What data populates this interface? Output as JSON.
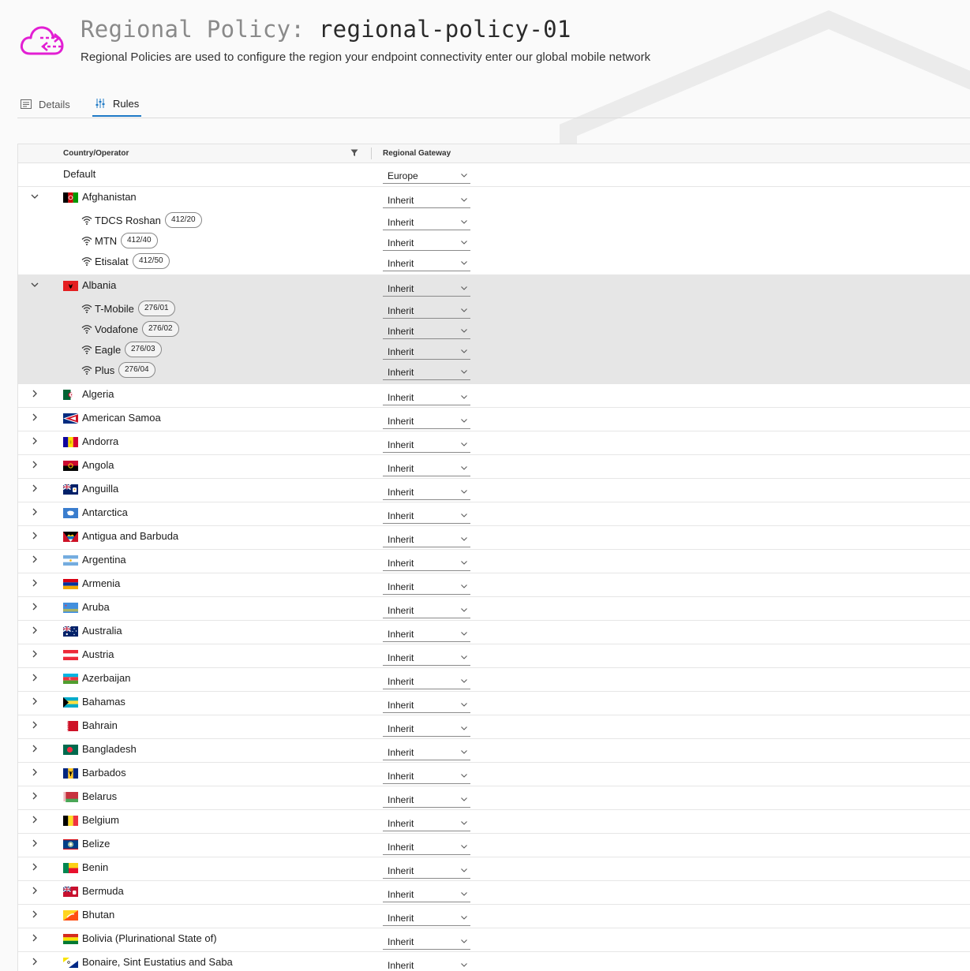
{
  "header": {
    "title_prefix": "Regional Policy:",
    "title_name": "regional-policy-01",
    "subtitle": "Regional Policies are used to configure the region your endpoint connectivity enter our global mobile network",
    "logo_color": "#e21fd3"
  },
  "tabs": [
    {
      "label": "Details",
      "icon": "details-icon",
      "active": false
    },
    {
      "label": "Rules",
      "icon": "sliders-icon",
      "active": true
    }
  ],
  "table": {
    "columns": {
      "country": "Country/Operator",
      "gateway": "Regional Gateway"
    },
    "default_row": {
      "label": "Default",
      "gateway": "Europe"
    },
    "countries": [
      {
        "name": "Afghanistan",
        "gateway": "Inherit",
        "expanded": true,
        "flag": "af",
        "operators": [
          {
            "name": "TDCS Roshan",
            "code": "412/20",
            "gateway": "Inherit"
          },
          {
            "name": "MTN",
            "code": "412/40",
            "gateway": "Inherit"
          },
          {
            "name": "Etisalat",
            "code": "412/50",
            "gateway": "Inherit"
          }
        ]
      },
      {
        "name": "Albania",
        "gateway": "Inherit",
        "expanded": true,
        "highlighted": true,
        "flag": "al",
        "operators": [
          {
            "name": "T-Mobile",
            "code": "276/01",
            "gateway": "Inherit"
          },
          {
            "name": "Vodafone",
            "code": "276/02",
            "gateway": "Inherit"
          },
          {
            "name": "Eagle",
            "code": "276/03",
            "gateway": "Inherit"
          },
          {
            "name": "Plus",
            "code": "276/04",
            "gateway": "Inherit"
          }
        ]
      },
      {
        "name": "Algeria",
        "gateway": "Inherit",
        "flag": "dz"
      },
      {
        "name": "American Samoa",
        "gateway": "Inherit",
        "flag": "as"
      },
      {
        "name": "Andorra",
        "gateway": "Inherit",
        "flag": "ad"
      },
      {
        "name": "Angola",
        "gateway": "Inherit",
        "flag": "ao"
      },
      {
        "name": "Anguilla",
        "gateway": "Inherit",
        "flag": "ai"
      },
      {
        "name": "Antarctica",
        "gateway": "Inherit",
        "flag": "aq"
      },
      {
        "name": "Antigua and Barbuda",
        "gateway": "Inherit",
        "flag": "ag"
      },
      {
        "name": "Argentina",
        "gateway": "Inherit",
        "flag": "ar"
      },
      {
        "name": "Armenia",
        "gateway": "Inherit",
        "flag": "am"
      },
      {
        "name": "Aruba",
        "gateway": "Inherit",
        "flag": "aw"
      },
      {
        "name": "Australia",
        "gateway": "Inherit",
        "flag": "au"
      },
      {
        "name": "Austria",
        "gateway": "Inherit",
        "flag": "at"
      },
      {
        "name": "Azerbaijan",
        "gateway": "Inherit",
        "flag": "az"
      },
      {
        "name": "Bahamas",
        "gateway": "Inherit",
        "flag": "bs"
      },
      {
        "name": "Bahrain",
        "gateway": "Inherit",
        "flag": "bh"
      },
      {
        "name": "Bangladesh",
        "gateway": "Inherit",
        "flag": "bd"
      },
      {
        "name": "Barbados",
        "gateway": "Inherit",
        "flag": "bb"
      },
      {
        "name": "Belarus",
        "gateway": "Inherit",
        "flag": "by"
      },
      {
        "name": "Belgium",
        "gateway": "Inherit",
        "flag": "be"
      },
      {
        "name": "Belize",
        "gateway": "Inherit",
        "flag": "bz"
      },
      {
        "name": "Benin",
        "gateway": "Inherit",
        "flag": "bj"
      },
      {
        "name": "Bermuda",
        "gateway": "Inherit",
        "flag": "bm"
      },
      {
        "name": "Bhutan",
        "gateway": "Inherit",
        "flag": "bt"
      },
      {
        "name": "Bolivia (Plurinational State of)",
        "gateway": "Inherit",
        "flag": "bo"
      },
      {
        "name": "Bonaire, Sint Eustatius and Saba",
        "gateway": "Inherit",
        "flag": "bq"
      }
    ]
  }
}
